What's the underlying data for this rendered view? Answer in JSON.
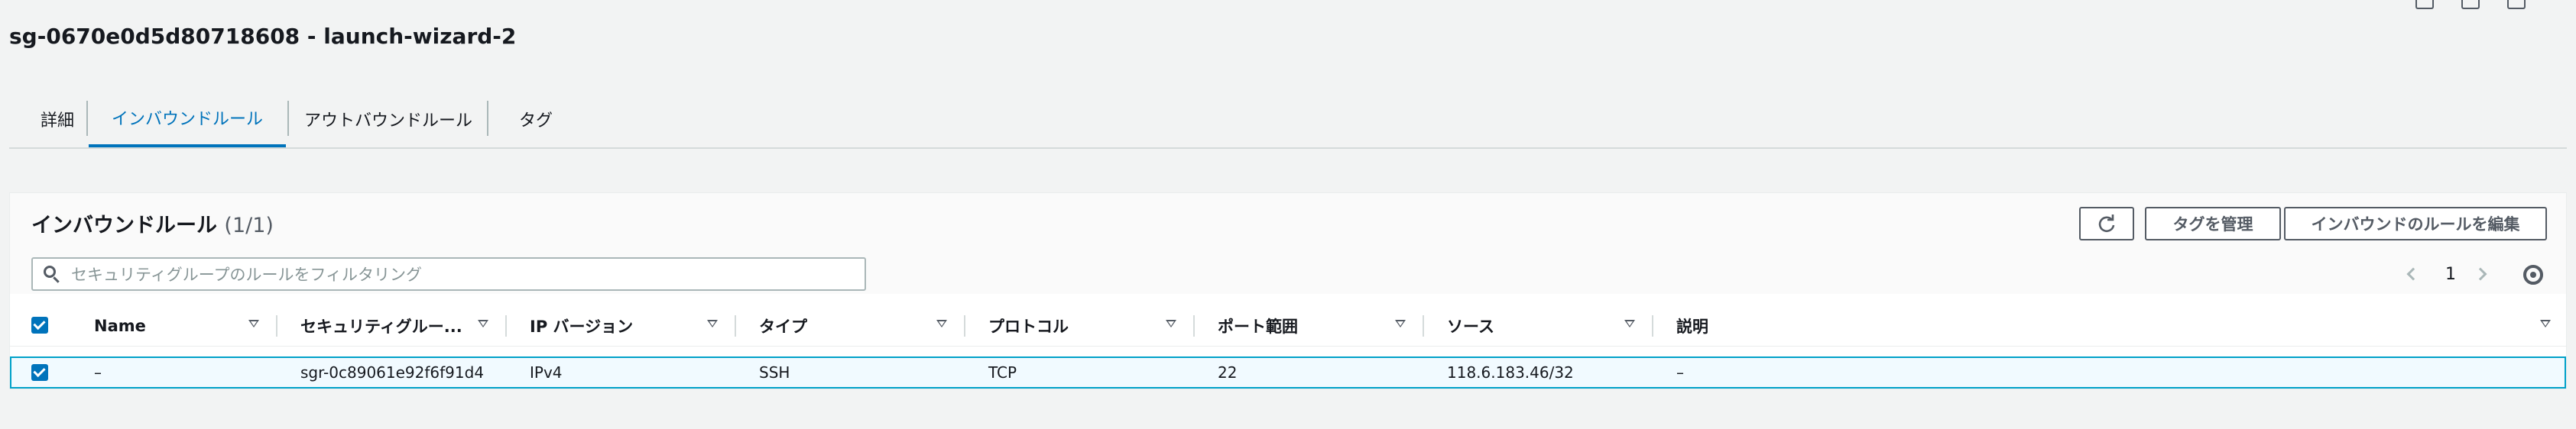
{
  "header": {
    "title": "sg-0670e0d5d80718608 - launch-wizard-2"
  },
  "tabs": [
    {
      "label": "詳細"
    },
    {
      "label": "インバウンドルール"
    },
    {
      "label": "アウトバウンドルール"
    },
    {
      "label": "タグ"
    }
  ],
  "panel": {
    "title": "インバウンドルール",
    "count": "(1/1)",
    "buttons": {
      "manage_tags": "タグを管理",
      "edit_rules": "インバウンドのルールを編集"
    },
    "search": {
      "placeholder": "セキュリティグループのルールをフィルタリング",
      "value": ""
    },
    "pagination": {
      "page": "1"
    }
  },
  "table": {
    "columns": [
      {
        "label": "Name"
      },
      {
        "label": "セキュリティグルー..."
      },
      {
        "label": "IP バージョン"
      },
      {
        "label": "タイプ"
      },
      {
        "label": "プロトコル"
      },
      {
        "label": "ポート範囲"
      },
      {
        "label": "ソース"
      },
      {
        "label": "説明"
      }
    ],
    "rows": [
      {
        "name": "–",
        "rule_id": "sgr-0c89061e92f6f91d4",
        "ip_version": "IPv4",
        "type": "SSH",
        "protocol": "TCP",
        "port_range": "22",
        "source": "118.6.183.46/32",
        "description": "–"
      }
    ]
  },
  "colors": {
    "accent": "#0073bb",
    "selected_row_border": "#00a1c9",
    "selected_row_bg": "#f1faff"
  }
}
